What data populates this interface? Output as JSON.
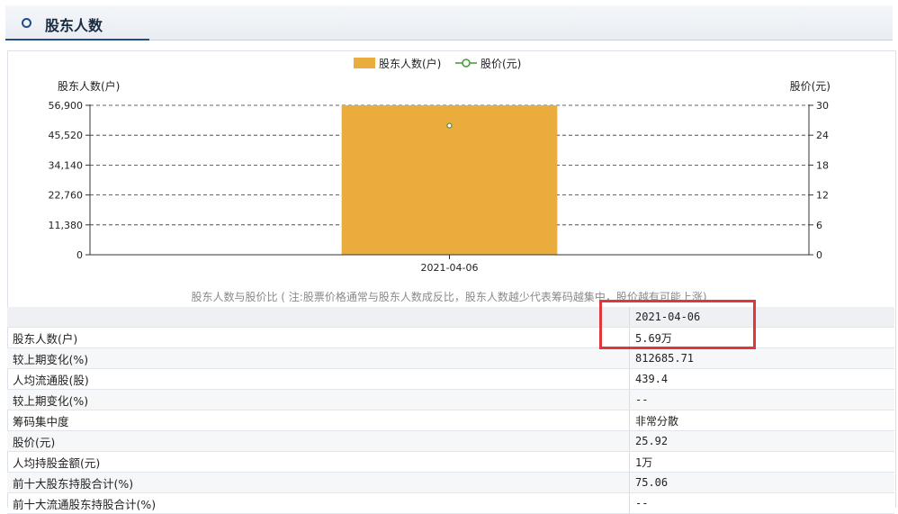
{
  "header": {
    "title": "股东人数"
  },
  "legend": {
    "bar_label": "股东人数(户)",
    "line_label": "股价(元)"
  },
  "axes": {
    "left_title": "股东人数(户)",
    "right_title": "股价(元)",
    "left_ticks": [
      "56,900",
      "45,520",
      "34,140",
      "22,760",
      "11,380",
      "0"
    ],
    "right_ticks": [
      "30",
      "24",
      "18",
      "12",
      "6",
      "0"
    ]
  },
  "chart_data": {
    "type": "bar",
    "categories": [
      "2021-04-06"
    ],
    "series": [
      {
        "name": "股东人数(户)",
        "values": [
          56900
        ],
        "axis": "left",
        "kind": "bar",
        "color": "#eaac3d"
      },
      {
        "name": "股价(元)",
        "values": [
          25.92
        ],
        "axis": "right",
        "kind": "line",
        "color": "#3e9c2f"
      }
    ],
    "ylim": [
      0,
      56900
    ],
    "y2lim": [
      0,
      30
    ],
    "grid": true
  },
  "caption": "股东人数与股价比 ( 注:股票价格通常与股东人数成反比，股东人数越少代表筹码越集中，股价越有可能上涨)",
  "table": {
    "date": "2021-04-06",
    "rows": [
      {
        "label": "股东人数(户)",
        "value": "5.69万"
      },
      {
        "label": "较上期变化(%)",
        "value": "812685.71"
      },
      {
        "label": "人均流通股(股)",
        "value": "439.4"
      },
      {
        "label": "较上期变化(%)",
        "value": "--"
      },
      {
        "label": "筹码集中度",
        "value": "非常分散"
      },
      {
        "label": "股价(元)",
        "value": "25.92"
      },
      {
        "label": "人均持股金额(元)",
        "value": "1万"
      },
      {
        "label": "前十大股东持股合计(%)",
        "value": "75.06"
      },
      {
        "label": "前十大流通股东持股合计(%)",
        "value": "--"
      }
    ]
  }
}
